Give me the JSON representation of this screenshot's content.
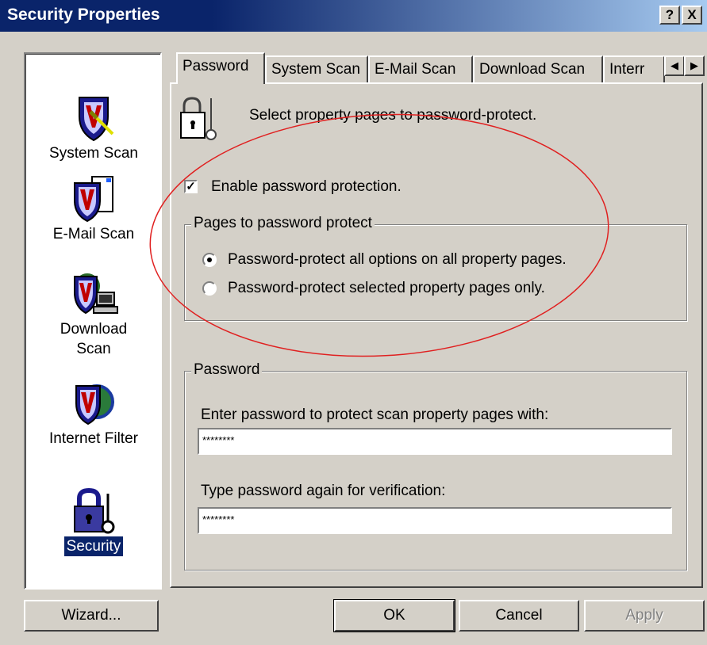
{
  "window": {
    "title": "Security Properties",
    "help_label": "?",
    "close_label": "X"
  },
  "sidebar": {
    "items": [
      {
        "label": "System Scan",
        "icon": "system-scan-shield-icon"
      },
      {
        "label": "E-Mail Scan",
        "icon": "email-scan-shield-icon"
      },
      {
        "label": "Download\nScan",
        "icon": "download-scan-shield-icon"
      },
      {
        "label": "Internet Filter",
        "icon": "internet-filter-shield-icon"
      },
      {
        "label": "Security",
        "icon": "padlock-key-icon",
        "selected": true
      }
    ]
  },
  "tabs": [
    "Password",
    "System Scan",
    "E-Mail Scan",
    "Download Scan",
    "Interr"
  ],
  "active_tab": "Password",
  "scroll": {
    "left": "◀",
    "right": "▶"
  },
  "page": {
    "description": "Select property pages to password-protect.",
    "enable_checkbox": {
      "label": "Enable password protection.",
      "checked": true,
      "mark": "✓"
    },
    "protect_group": {
      "title": "Pages to password protect",
      "options": [
        {
          "label": "Password-protect all options on all property pages.",
          "selected": true
        },
        {
          "label": "Password-protect selected property pages only.",
          "selected": false
        }
      ]
    },
    "password_group": {
      "title": "Password",
      "enter_label": "Enter password to protect scan property pages with:",
      "enter_value": "********",
      "verify_label": "Type password again for verification:",
      "verify_value": "********"
    }
  },
  "buttons": {
    "wizard": "Wizard...",
    "ok": "OK",
    "cancel": "Cancel",
    "apply": "Apply"
  },
  "colors": {
    "title_bar": "#0a246a",
    "selection": "#0a246a",
    "annotation_ellipse": "#e02020",
    "face": "#d4d0c8"
  }
}
